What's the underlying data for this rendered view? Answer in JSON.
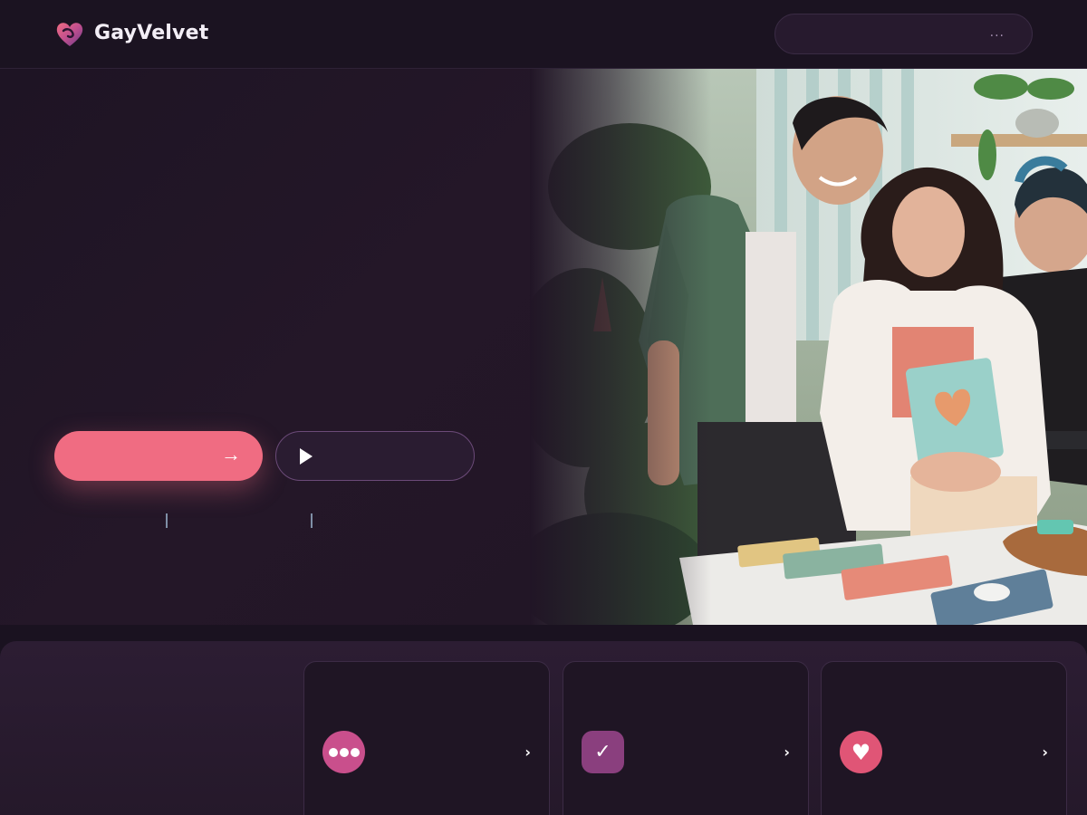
{
  "header": {
    "brand": "GayVelvet",
    "search": {
      "value": "..."
    }
  },
  "hero": {
    "primary_cta_icon": "arrow-right-icon",
    "secondary_cta_icon": "play-icon",
    "image": "illustration of three smiling people at a table with books",
    "colors": {
      "accent": "#f06c82",
      "background": "#1a1220"
    }
  },
  "features": {
    "cards": [
      {
        "icon": "chat-dots-icon",
        "chevron": "›"
      },
      {
        "icon": "check-icon",
        "chevron": "›"
      },
      {
        "icon": "heart-icon",
        "chevron": "›"
      }
    ]
  }
}
